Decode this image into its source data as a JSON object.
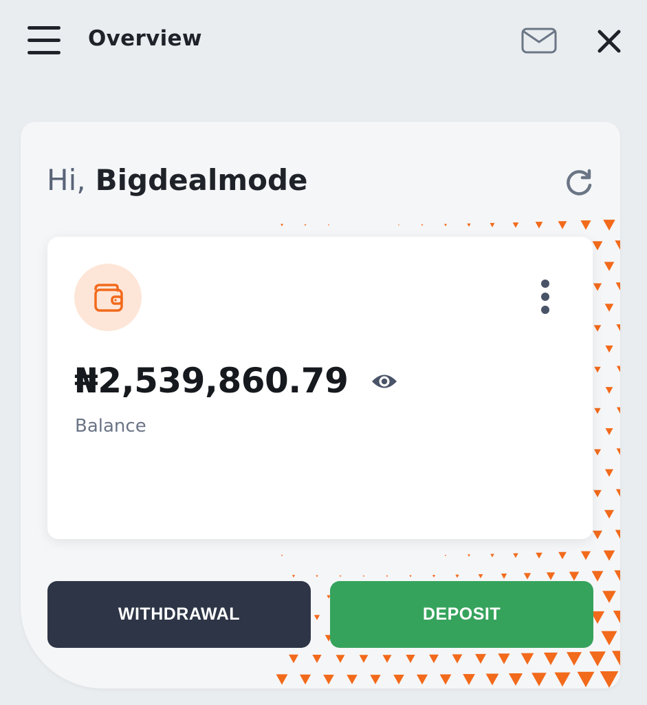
{
  "header": {
    "title": "Overview",
    "menu_icon": "hamburger-menu-icon",
    "mail_icon": "envelope-icon",
    "close_icon": "close-icon"
  },
  "greeting": {
    "hi": "Hi,",
    "name": "Bigdealmode",
    "refresh_icon": "refresh-icon"
  },
  "balance_card": {
    "amount": "₦2,539,860.79",
    "label": "Balance",
    "wallet_icon": "wallet-icon",
    "visibility_icon": "eye-icon",
    "options_icon": "more-vertical-icon"
  },
  "actions": {
    "withdrawal_label": "WITHDRAWAL",
    "deposit_label": "DEPOSIT"
  },
  "colors": {
    "accent": "#f26a1b",
    "withdraw_button": "#2d3546",
    "deposit_button": "#36a35c",
    "background": "#eaedf0"
  }
}
